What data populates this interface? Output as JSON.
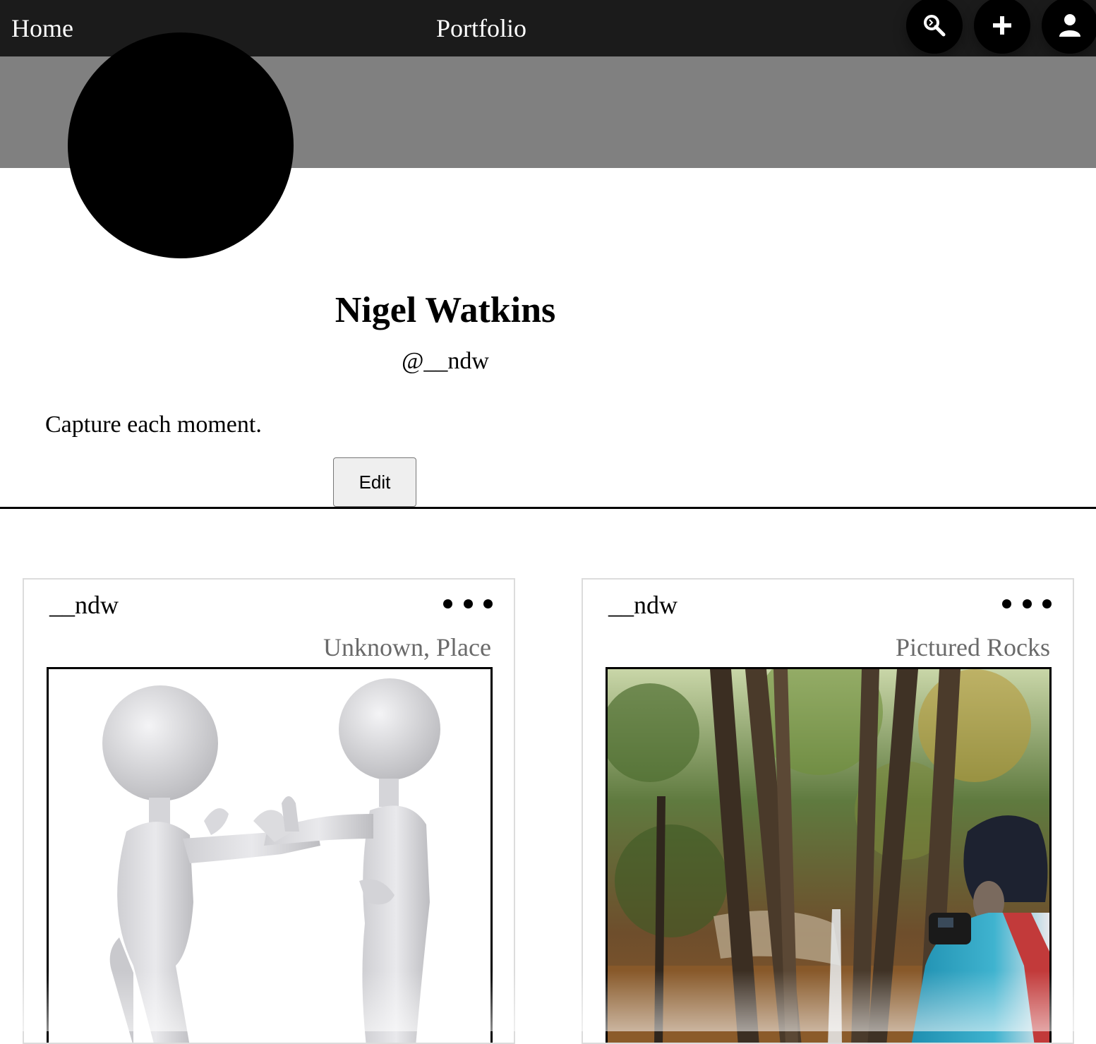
{
  "nav": {
    "home_label": "Home",
    "title": "Portfolio",
    "icons": [
      "search-icon",
      "plus-icon",
      "user-icon"
    ]
  },
  "profile": {
    "name": "Nigel Watkins",
    "handle": "@__ndw",
    "bio": "Capture each moment.",
    "edit_label": "Edit"
  },
  "posts": [
    {
      "username": "__ndw",
      "location": "Unknown, Place",
      "image": "two-3d-figures-handshake"
    },
    {
      "username": "__ndw",
      "location": "Pictured Rocks",
      "image": "forest-waterfall-hiker"
    }
  ],
  "colors": {
    "topbar": "#1b1b1b",
    "banner": "#808080",
    "location_text": "#6a6a6a"
  }
}
